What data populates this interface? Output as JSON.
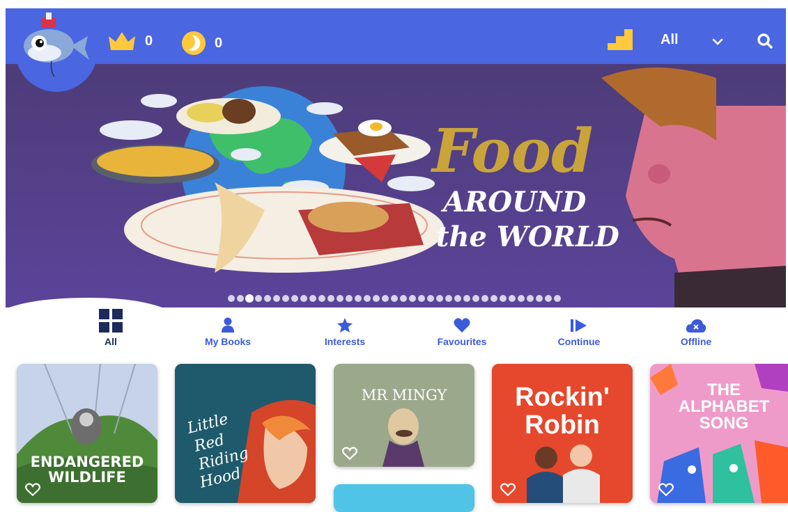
{
  "header": {
    "crowns": "0",
    "coins": "0",
    "filter_label": "All",
    "icons": [
      "crown-icon",
      "coin-icon",
      "levels-icon",
      "chevron-down-icon",
      "search-icon"
    ]
  },
  "banner": {
    "title_line1": "Food",
    "title_line2": "AROUND",
    "title_line3": "the WORLD",
    "carousel_total": 37,
    "carousel_active_index": 2
  },
  "tabs": [
    {
      "label": "All",
      "icon": "grid-icon",
      "active": true
    },
    {
      "label": "My Books",
      "icon": "person-icon",
      "active": false
    },
    {
      "label": "Interests",
      "icon": "star-icon",
      "active": false
    },
    {
      "label": "Favourites",
      "icon": "heart-icon",
      "active": false
    },
    {
      "label": "Continue",
      "icon": "play-icon",
      "active": false
    },
    {
      "label": "Offline",
      "icon": "cloud-icon",
      "active": false
    }
  ],
  "books": [
    {
      "title_line1": "ENDANGERED",
      "title_line2": "WILDLIFE"
    },
    {
      "title_line1": "Little",
      "title_line2": "Red",
      "title_line3": "Riding",
      "title_line4": "Hood"
    },
    {
      "title_line1": "MR MINGY"
    },
    {
      "title_line1": "Rockin'",
      "title_line2": "Robin"
    },
    {
      "title_line1": "THE",
      "title_line2": "ALPHABET",
      "title_line3": "SONG"
    }
  ],
  "colors": {
    "primary": "#4a66e0",
    "banner_bg": "#4f3e78",
    "tab_blue": "#3b5bdb",
    "tab_active": "#1e2a5a"
  }
}
